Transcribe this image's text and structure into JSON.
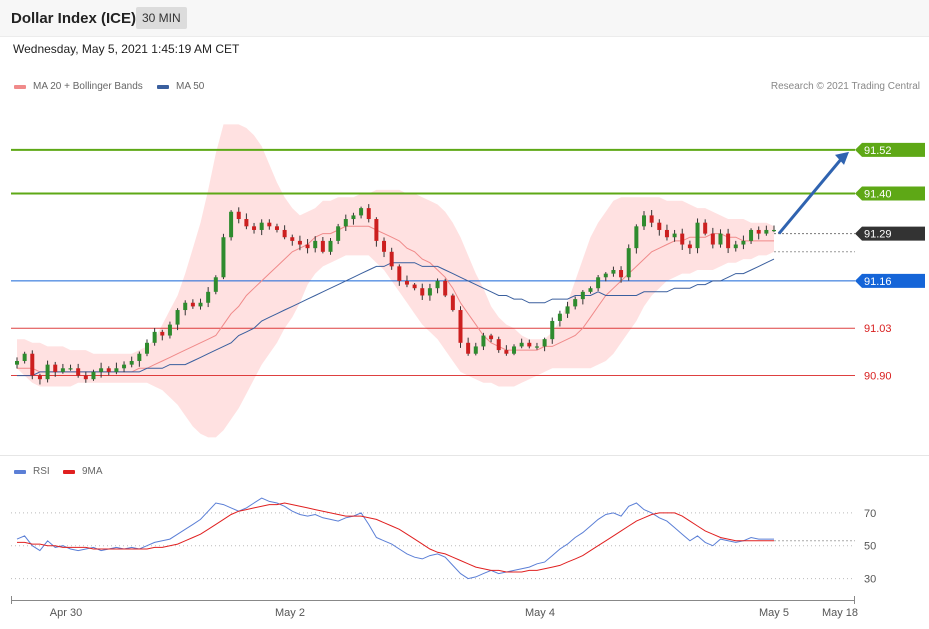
{
  "header": {
    "title": "Dollar Index (ICE)",
    "timeframe": "30 MIN"
  },
  "datetime": "Wednesday, May 5, 2021 1:45:19 AM CET",
  "legend": {
    "ma20": {
      "label": "MA 20 + Bollinger Bands",
      "color": "#f08a8a"
    },
    "ma50": {
      "label": "MA 50",
      "color": "#3a5f9e"
    }
  },
  "copyright": "Research © 2021 Trading Central",
  "rsi_legend": {
    "rsi": {
      "label": "RSI",
      "color": "#5b7fd6"
    },
    "ma9": {
      "label": "9MA",
      "color": "#e02020"
    }
  },
  "chart_data": [
    {
      "type": "candlestick",
      "ylim": [
        90.69,
        91.69
      ],
      "last_price": 91.29,
      "levels": [
        {
          "value": 91.52,
          "label": "91.52",
          "style": "resistance",
          "color": "#5ea816"
        },
        {
          "value": 91.4,
          "label": "91.40",
          "style": "resistance",
          "color": "#5ea816"
        },
        {
          "value": 91.29,
          "label": "91.29",
          "style": "price",
          "color": "#333333"
        },
        {
          "value": 91.16,
          "label": "91.16",
          "style": "pivot",
          "color": "#1565d8"
        },
        {
          "value": 91.03,
          "label": "91.03",
          "style": "support",
          "color": "#d81e1e"
        },
        {
          "value": 90.9,
          "label": "90.90",
          "style": "support",
          "color": "#d81e1e"
        }
      ],
      "closes": [
        90.94,
        90.96,
        90.9,
        90.89,
        90.93,
        90.91,
        90.92,
        90.92,
        90.9,
        90.89,
        90.91,
        90.92,
        90.91,
        90.92,
        90.93,
        90.94,
        90.96,
        90.99,
        91.02,
        91.01,
        91.04,
        91.08,
        91.1,
        91.09,
        91.1,
        91.13,
        91.17,
        91.28,
        91.35,
        91.33,
        91.31,
        91.3,
        91.32,
        91.31,
        91.3,
        91.28,
        91.27,
        91.26,
        91.25,
        91.27,
        91.24,
        91.27,
        91.31,
        91.33,
        91.34,
        91.36,
        91.33,
        91.27,
        91.24,
        91.2,
        91.16,
        91.15,
        91.14,
        91.12,
        91.14,
        91.16,
        91.12,
        91.08,
        90.99,
        90.96,
        90.98,
        91.01,
        91.0,
        90.97,
        90.96,
        90.98,
        90.99,
        90.98,
        90.98,
        91.0,
        91.05,
        91.07,
        91.09,
        91.11,
        91.13,
        91.14,
        91.17,
        91.18,
        91.19,
        91.17,
        91.25,
        91.31,
        91.34,
        91.32,
        91.3,
        91.28,
        91.29,
        91.26,
        91.25,
        91.32,
        91.29,
        91.26,
        91.29,
        91.25,
        91.26,
        91.27,
        91.3,
        91.29,
        91.3,
        91.3
      ],
      "ma20": [
        90.92,
        90.92,
        90.92,
        90.91,
        90.91,
        90.91,
        90.91,
        90.91,
        90.91,
        90.91,
        90.91,
        90.91,
        90.91,
        90.91,
        90.91,
        90.91,
        90.92,
        90.92,
        90.93,
        90.94,
        90.95,
        90.96,
        90.97,
        90.98,
        90.99,
        91.0,
        91.01,
        91.04,
        91.07,
        91.09,
        91.12,
        91.14,
        91.16,
        91.18,
        91.2,
        91.22,
        91.24,
        91.25,
        91.26,
        91.28,
        91.29,
        91.29,
        91.3,
        91.31,
        91.31,
        91.31,
        91.31,
        91.3,
        91.29,
        91.28,
        91.27,
        91.25,
        91.24,
        91.22,
        91.21,
        91.19,
        91.17,
        91.14,
        91.1,
        91.07,
        91.04,
        91.01,
        90.99,
        90.98,
        90.97,
        90.97,
        90.97,
        90.97,
        90.97,
        90.98,
        90.98,
        90.99,
        91.0,
        91.01,
        91.03,
        91.06,
        91.09,
        91.12,
        91.14,
        91.16,
        91.18,
        91.2,
        91.22,
        91.24,
        91.25,
        91.26,
        91.27,
        91.27,
        91.28,
        91.28,
        91.28,
        91.29,
        91.29,
        91.28,
        91.28,
        91.27,
        91.27,
        91.27,
        91.27,
        91.27
      ],
      "ma50": [
        90.9,
        90.9,
        90.9,
        90.91,
        90.91,
        90.91,
        90.91,
        90.91,
        90.91,
        90.91,
        90.91,
        90.91,
        90.91,
        90.91,
        90.91,
        90.91,
        90.91,
        90.92,
        90.92,
        90.92,
        90.93,
        90.93,
        90.93,
        90.94,
        90.95,
        90.96,
        90.97,
        90.98,
        90.99,
        91.01,
        91.02,
        91.03,
        91.05,
        91.06,
        91.07,
        91.08,
        91.09,
        91.1,
        91.11,
        91.12,
        91.13,
        91.14,
        91.15,
        91.16,
        91.17,
        91.18,
        91.19,
        91.2,
        91.2,
        91.21,
        91.21,
        91.21,
        91.21,
        91.2,
        91.2,
        91.2,
        91.19,
        91.18,
        91.17,
        91.16,
        91.15,
        91.14,
        91.13,
        91.12,
        91.12,
        91.11,
        91.11,
        91.1,
        91.1,
        91.1,
        91.11,
        91.11,
        91.11,
        91.12,
        91.12,
        91.12,
        91.13,
        91.12,
        91.12,
        91.12,
        91.12,
        91.12,
        91.13,
        91.13,
        91.13,
        91.13,
        91.14,
        91.14,
        91.14,
        91.15,
        91.15,
        91.16,
        91.16,
        91.17,
        91.18,
        91.18,
        91.19,
        91.2,
        91.21,
        91.22
      ],
      "bb_upper": [
        91.0,
        91.0,
        90.99,
        90.99,
        90.98,
        90.98,
        90.98,
        90.97,
        90.97,
        90.97,
        90.96,
        90.96,
        90.96,
        90.96,
        90.96,
        90.96,
        90.97,
        90.98,
        91.0,
        91.04,
        91.08,
        91.12,
        91.18,
        91.25,
        91.32,
        91.41,
        91.51,
        91.59,
        91.59,
        91.59,
        91.58,
        91.56,
        91.53,
        91.48,
        91.43,
        91.39,
        91.36,
        91.34,
        91.35,
        91.36,
        91.38,
        91.38,
        91.39,
        91.39,
        91.39,
        91.4,
        91.4,
        91.41,
        91.41,
        91.41,
        91.41,
        91.4,
        91.4,
        91.39,
        91.38,
        91.37,
        91.35,
        91.32,
        91.28,
        91.23,
        91.18,
        91.14,
        91.09,
        91.06,
        91.04,
        91.03,
        91.01,
        91.0,
        91.0,
        91.0,
        91.02,
        91.05,
        91.1,
        91.16,
        91.22,
        91.28,
        91.32,
        91.35,
        91.38,
        91.39,
        91.39,
        91.39,
        91.39,
        91.39,
        91.39,
        91.38,
        91.38,
        91.38,
        91.37,
        91.36,
        91.36,
        91.35,
        91.34,
        91.33,
        91.33,
        91.33,
        91.32,
        91.32,
        91.32,
        91.31
      ],
      "bb_lower": [
        90.92,
        90.9,
        90.88,
        90.87,
        90.87,
        90.87,
        90.87,
        90.87,
        90.88,
        90.88,
        90.88,
        90.88,
        90.88,
        90.88,
        90.88,
        90.88,
        90.88,
        90.88,
        90.87,
        90.86,
        90.84,
        90.82,
        90.79,
        90.76,
        90.74,
        90.73,
        90.73,
        90.75,
        90.78,
        90.81,
        90.85,
        90.89,
        90.93,
        90.96,
        90.99,
        91.03,
        91.06,
        91.1,
        91.15,
        91.18,
        91.2,
        91.21,
        91.22,
        91.23,
        91.23,
        91.23,
        91.23,
        91.21,
        91.19,
        91.16,
        91.13,
        91.1,
        91.07,
        91.04,
        91.02,
        91.0,
        90.97,
        90.94,
        90.91,
        90.9,
        90.89,
        90.88,
        90.88,
        90.87,
        90.87,
        90.87,
        90.88,
        90.89,
        90.9,
        90.91,
        90.92,
        90.92,
        90.92,
        90.92,
        90.92,
        90.92,
        90.93,
        90.94,
        90.96,
        90.99,
        91.02,
        91.05,
        91.09,
        91.12,
        91.14,
        91.16,
        91.17,
        91.18,
        91.18,
        91.19,
        91.19,
        91.19,
        91.2,
        91.21,
        91.21,
        91.22,
        91.22,
        91.23,
        91.23,
        91.24
      ]
    },
    {
      "type": "line",
      "yticks": [
        70,
        50,
        30
      ],
      "ylim": [
        20,
        90
      ],
      "x_ticks": [
        "Apr 30",
        "May 2",
        "May 4",
        "May 5",
        "May 18"
      ],
      "series": [
        {
          "name": "RSI",
          "color": "#5b7fd6",
          "values": [
            54,
            56,
            50,
            47,
            53,
            49,
            50,
            48,
            47,
            48,
            49,
            47,
            48,
            49,
            48,
            49,
            48,
            50,
            52,
            53,
            54,
            57,
            60,
            63,
            66,
            71,
            76,
            75,
            73,
            71,
            73,
            76,
            79,
            77,
            76,
            74,
            71,
            69,
            68,
            69,
            67,
            66,
            65,
            67,
            68,
            70,
            63,
            55,
            53,
            51,
            48,
            45,
            43,
            42,
            44,
            45,
            43,
            38,
            33,
            30,
            31,
            33,
            35,
            33,
            34,
            35,
            36,
            37,
            39,
            40,
            44,
            48,
            51,
            55,
            58,
            62,
            66,
            69,
            70,
            68,
            74,
            76,
            72,
            70,
            67,
            65,
            61,
            57,
            53,
            56,
            52,
            50,
            54,
            53,
            52,
            53,
            55,
            54,
            54,
            54
          ]
        },
        {
          "name": "9MA",
          "color": "#e02020",
          "values": [
            52,
            52,
            51,
            51,
            50,
            50,
            49,
            49,
            49,
            49,
            48,
            48,
            48,
            48,
            48,
            48,
            48,
            48,
            49,
            49,
            50,
            51,
            53,
            55,
            57,
            60,
            63,
            66,
            69,
            71,
            72,
            73,
            74,
            75,
            75,
            76,
            75,
            74,
            73,
            72,
            71,
            70,
            69,
            68,
            68,
            68,
            67,
            66,
            64,
            62,
            60,
            57,
            54,
            51,
            48,
            46,
            45,
            43,
            41,
            39,
            37,
            36,
            35,
            35,
            34,
            34,
            34,
            35,
            35,
            36,
            37,
            38,
            40,
            42,
            44,
            47,
            50,
            53,
            56,
            59,
            62,
            65,
            67,
            69,
            70,
            70,
            70,
            68,
            65,
            62,
            59,
            57,
            55,
            54,
            53,
            53,
            53,
            53,
            53,
            53
          ]
        }
      ]
    }
  ]
}
